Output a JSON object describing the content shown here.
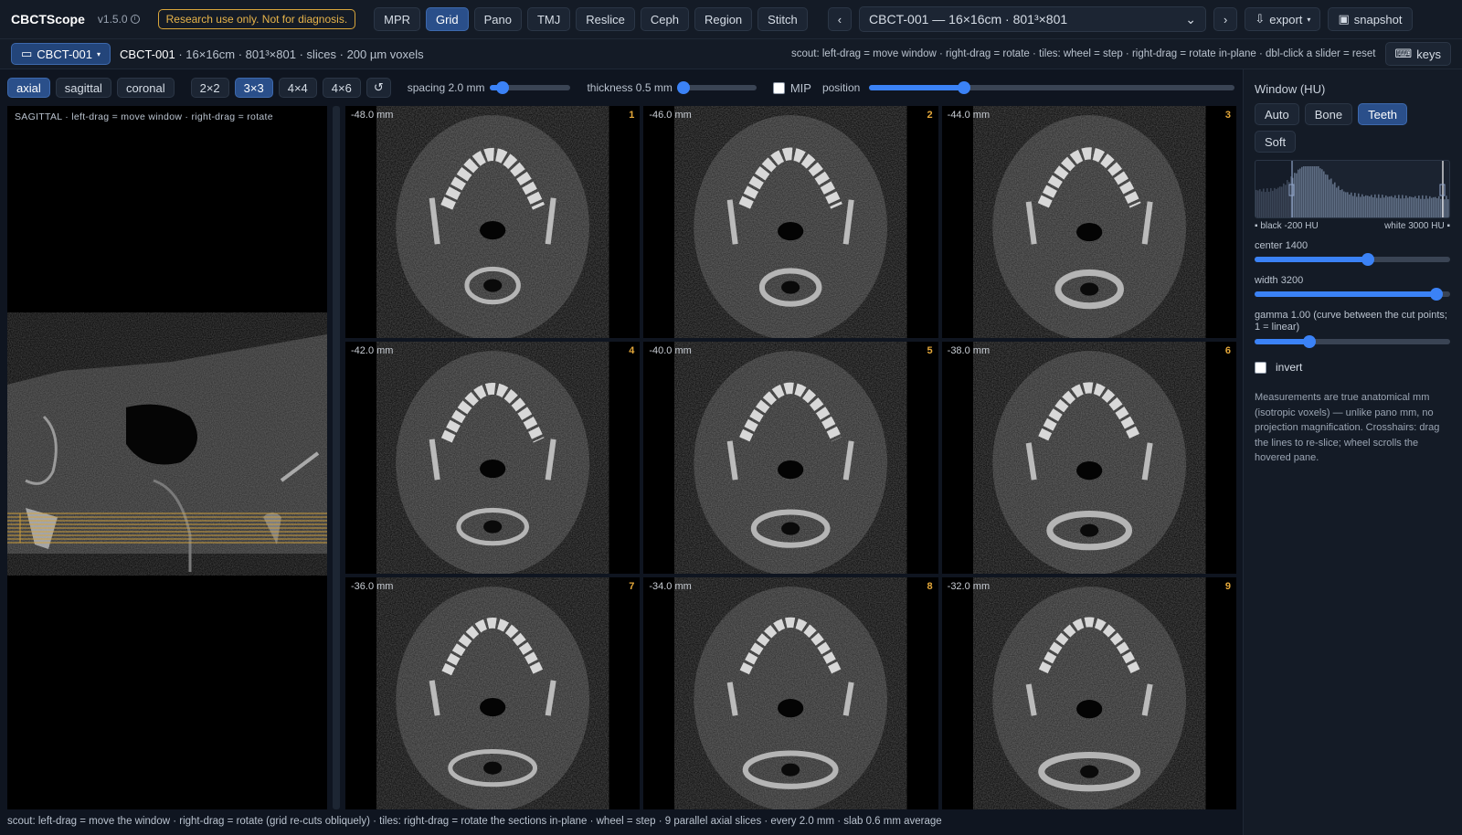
{
  "app": {
    "name": "CBCTScope",
    "version": "v1.5.0",
    "warning": "Research use only. Not for diagnosis."
  },
  "modes": [
    {
      "label": "MPR",
      "active": false
    },
    {
      "label": "Grid",
      "active": true
    },
    {
      "label": "Pano",
      "active": false
    },
    {
      "label": "TMJ",
      "active": false
    },
    {
      "label": "Reslice",
      "active": false
    },
    {
      "label": "Ceph",
      "active": false
    },
    {
      "label": "Region",
      "active": false
    },
    {
      "label": "Stitch",
      "active": false
    }
  ],
  "nav": {
    "prev": "‹",
    "next": "›",
    "case_select": "CBCT-001 — 16×16cm · 801³×801",
    "export": "export",
    "snapshot": "snapshot"
  },
  "subbar": {
    "case_chip": "CBCT-001",
    "case_name": "CBCT-001",
    "case_details": " · 16×16cm · 801³×801 · slices · 200 µm voxels",
    "hint": "scout: left-drag = move window · right-drag = rotate · tiles: wheel = step · right-drag = rotate in-plane · dbl-click a slider = reset",
    "keys": "keys"
  },
  "toolbar": {
    "planes": [
      {
        "label": "axial",
        "active": true
      },
      {
        "label": "sagittal",
        "active": false
      },
      {
        "label": "coronal",
        "active": false
      }
    ],
    "layouts": [
      {
        "label": "2×2",
        "active": false
      },
      {
        "label": "3×3",
        "active": true
      },
      {
        "label": "4×4",
        "active": false
      },
      {
        "label": "4×6",
        "active": false
      }
    ],
    "spacing_label": "spacing 2.0 mm",
    "spacing_value": 0.15,
    "thickness_label": "thickness 0.5 mm",
    "thickness_value": 0.0,
    "mip_label": "MIP",
    "position_label": "position",
    "position_value": 0.26
  },
  "scout": {
    "label": "SAGITTAL · left-drag = move window · right-drag = rotate"
  },
  "tiles": [
    {
      "pos": "-48.0 mm",
      "idx": "1"
    },
    {
      "pos": "-46.0 mm",
      "idx": "2"
    },
    {
      "pos": "-44.0 mm",
      "idx": "3"
    },
    {
      "pos": "-42.0 mm",
      "idx": "4"
    },
    {
      "pos": "-40.0 mm",
      "idx": "5"
    },
    {
      "pos": "-38.0 mm",
      "idx": "6"
    },
    {
      "pos": "-36.0 mm",
      "idx": "7"
    },
    {
      "pos": "-34.0 mm",
      "idx": "8"
    },
    {
      "pos": "-32.0 mm",
      "idx": "9"
    }
  ],
  "bottom_hint": "scout: left-drag = move the window · right-drag = rotate (grid re-cuts obliquely) · tiles: right-drag = rotate the sections in-plane · wheel = step · 9 parallel axial slices · every 2.0 mm · slab 0.6 mm average",
  "window": {
    "title": "Window (HU)",
    "presets": [
      {
        "label": "Auto",
        "active": false
      },
      {
        "label": "Bone",
        "active": false
      },
      {
        "label": "Teeth",
        "active": true
      },
      {
        "label": "Soft",
        "active": false
      }
    ],
    "black_label": "▪ black -200 HU",
    "white_label": "white 3000 HU ▪",
    "center_label": "center 1400",
    "center_value": 0.58,
    "width_label": "width 3200",
    "width_value": 0.93,
    "gamma_label": "gamma 1.00 (curve between the cut points; 1 = linear)",
    "gamma_value": 0.28,
    "invert_label": "invert",
    "note": "Measurements are true anatomical mm (isotropic voxels) — unlike pano mm, no projection magnification. Crosshairs: drag the lines to re-slice; wheel scrolls the hovered pane."
  },
  "colors": {
    "accent": "#3b82f6",
    "active_btn": "#2a4f8a",
    "warning": "#e7b44a",
    "slice_line": "#d9a63b"
  }
}
